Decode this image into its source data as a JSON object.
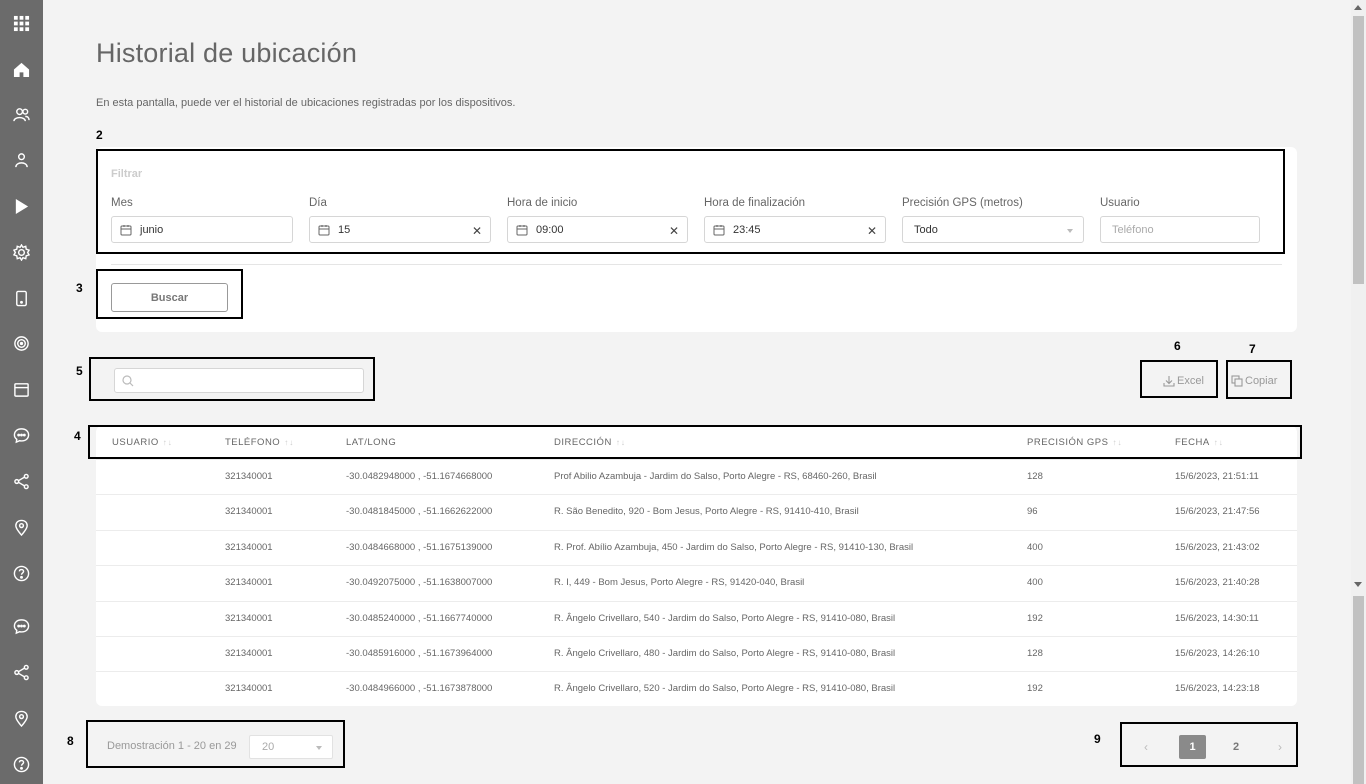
{
  "sidebar": {
    "items": [
      {
        "icon": "apps-grid-icon"
      },
      {
        "icon": "home-icon"
      },
      {
        "icon": "users-icon"
      },
      {
        "icon": "user-icon"
      },
      {
        "icon": "play-store-icon"
      },
      {
        "icon": "settings-gear-icon"
      },
      {
        "icon": "device-phone-icon"
      },
      {
        "icon": "target-icon"
      },
      {
        "icon": "calendar-icon"
      },
      {
        "icon": "chat-icon"
      },
      {
        "icon": "share-icon"
      },
      {
        "icon": "location-pin-icon"
      },
      {
        "icon": "help-icon"
      },
      {
        "icon": "chat-icon"
      },
      {
        "icon": "share-icon"
      },
      {
        "icon": "location-pin-icon"
      },
      {
        "icon": "help-icon"
      }
    ]
  },
  "page": {
    "title": "Historial de ubicación",
    "description": "En esta pantalla, puede ver el historial de ubicaciones registradas por los dispositivos."
  },
  "markers": {
    "m2": "2",
    "m3": "3",
    "m4": "4",
    "m5": "5",
    "m6": "6",
    "m7": "7",
    "m8": "8",
    "m9": "9"
  },
  "filter": {
    "title": "Filtrar",
    "mes": {
      "label": "Mes",
      "value": "junio"
    },
    "dia": {
      "label": "Día",
      "value": "15",
      "clear": "✕"
    },
    "hora_inicio": {
      "label": "Hora de inicio",
      "value": "09:00",
      "clear": "✕"
    },
    "hora_fin": {
      "label": "Hora de finalización",
      "value": "23:45",
      "clear": "✕"
    },
    "precision": {
      "label": "Precisión GPS (metros)",
      "value": "Todo"
    },
    "usuario": {
      "label": "Usuario",
      "placeholder": "Teléfono"
    },
    "search_button": "Buscar"
  },
  "toolbar": {
    "search_placeholder": "",
    "excel_label": "Excel",
    "copy_label": "Copiar"
  },
  "table": {
    "columns": [
      "USUARIO",
      "TELÉFONO",
      "LAT/LONG",
      "DIRECCIÓN",
      "PRECISIÓN GPS",
      "FECHA"
    ],
    "sort_glyph": "↑↓",
    "rows": [
      {
        "usuario": "",
        "telefono": "321340001",
        "latlong": "-30.0482948000 , -51.1674668000",
        "direccion": "Prof Abilio Azambuja - Jardim do Salso, Porto Alegre - RS, 68460-260, Brasil",
        "precision": "128",
        "fecha": "15/6/2023, 21:51:11"
      },
      {
        "usuario": "",
        "telefono": "321340001",
        "latlong": "-30.0481845000 , -51.1662622000",
        "direccion": "R. São Benedito, 920 - Bom Jesus, Porto Alegre - RS, 91410-410, Brasil",
        "precision": "96",
        "fecha": "15/6/2023, 21:47:56"
      },
      {
        "usuario": "",
        "telefono": "321340001",
        "latlong": "-30.0484668000 , -51.1675139000",
        "direccion": "R. Prof. Abílio Azambuja, 450 - Jardim do Salso, Porto Alegre - RS, 91410-130, Brasil",
        "precision": "400",
        "fecha": "15/6/2023, 21:43:02"
      },
      {
        "usuario": "",
        "telefono": "321340001",
        "latlong": "-30.0492075000 , -51.1638007000",
        "direccion": "R. I, 449 - Bom Jesus, Porto Alegre - RS, 91420-040, Brasil",
        "precision": "400",
        "fecha": "15/6/2023, 21:40:28"
      },
      {
        "usuario": "",
        "telefono": "321340001",
        "latlong": "-30.0485240000 , -51.1667740000",
        "direccion": "R. Ângelo Crivellaro, 540 - Jardim do Salso, Porto Alegre - RS, 91410-080, Brasil",
        "precision": "192",
        "fecha": "15/6/2023, 14:30:11"
      },
      {
        "usuario": "",
        "telefono": "321340001",
        "latlong": "-30.0485916000 , -51.1673964000",
        "direccion": "R. Ângelo Crivellaro, 480 - Jardim do Salso, Porto Alegre - RS, 91410-080, Brasil",
        "precision": "128",
        "fecha": "15/6/2023, 14:26:10"
      },
      {
        "usuario": "",
        "telefono": "321340001",
        "latlong": "-30.0484966000 , -51.1673878000",
        "direccion": "R. Ângelo Crivellaro, 520 - Jardim do Salso, Porto Alegre - RS, 91410-080, Brasil",
        "precision": "192",
        "fecha": "15/6/2023, 14:23:18"
      }
    ]
  },
  "pagination": {
    "summary": "Demostración 1 - 20 en 29",
    "page_size": "20",
    "prev": "‹",
    "pages": [
      "1",
      "2"
    ],
    "next": "›"
  }
}
